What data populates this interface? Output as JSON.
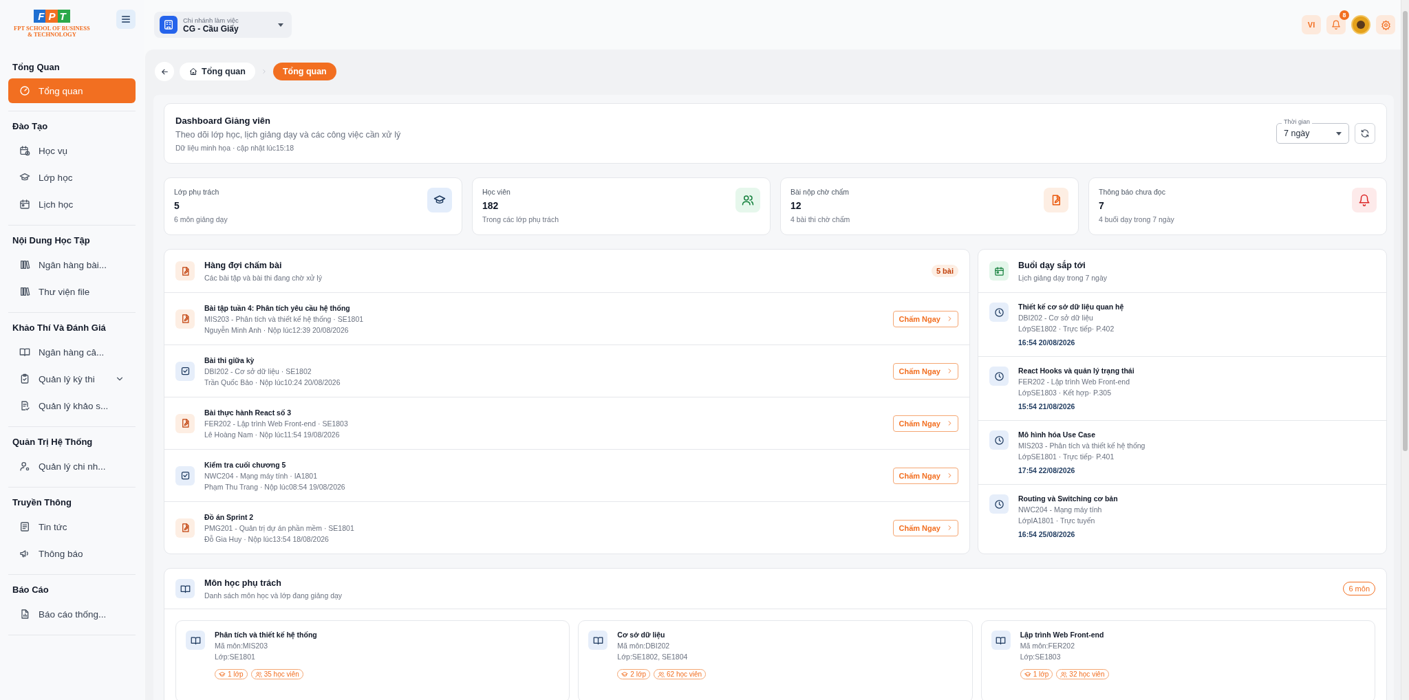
{
  "sidebar": {
    "logo": {
      "mark": "FPT",
      "lines": [
        "FPT SCHOOL OF BUSINESS",
        "& TECHNOLOGY"
      ]
    },
    "sections": [
      {
        "title": "Tổng Quan",
        "items": [
          {
            "label": "Tổng quan",
            "kind": "link",
            "selected": true
          }
        ]
      },
      {
        "title": "Đào Tạo",
        "items": [
          {
            "label": "Học vụ",
            "kind": "link",
            "selected": false
          },
          {
            "label": "Lớp học",
            "kind": "link",
            "selected": false
          },
          {
            "label": "Lịch học",
            "kind": "link",
            "selected": false
          }
        ]
      },
      {
        "title": "Nội Dung Học Tập",
        "items": [
          {
            "label": "Ngân hàng bài...",
            "kind": "link",
            "selected": false
          },
          {
            "label": "Thư viện file",
            "kind": "link",
            "selected": false
          }
        ]
      },
      {
        "title": "Khảo Thí Và Đánh Giá",
        "items": [
          {
            "label": "Ngân hàng câ...",
            "kind": "link",
            "selected": false
          },
          {
            "label": "Quản lý kỳ thi",
            "kind": "group",
            "selected": false
          },
          {
            "label": "Quản lý khảo s...",
            "kind": "link",
            "selected": false
          }
        ]
      },
      {
        "title": "Quản Trị Hệ Thống",
        "items": [
          {
            "label": "Quản lý chi nh...",
            "kind": "link",
            "selected": false
          }
        ]
      },
      {
        "title": "Truyền Thông",
        "items": [
          {
            "label": "Tin tức",
            "kind": "link",
            "selected": false
          },
          {
            "label": "Thông báo",
            "kind": "link",
            "selected": false
          }
        ]
      },
      {
        "title": "Báo Cáo",
        "items": [
          {
            "label": "Báo cáo thống...",
            "kind": "link",
            "selected": false
          }
        ]
      }
    ]
  },
  "header": {
    "branch": {
      "label": "Chi nhánh làm việc",
      "value": "CG - Cầu Giấy"
    },
    "language": "VI",
    "notification_count": "8"
  },
  "breadcrumb": [
    {
      "label": "Tổng quan",
      "selected": false
    },
    {
      "label": "Tổng quan",
      "selected": true
    }
  ],
  "dashboard_header": {
    "title": "Dashboard Giảng viên",
    "subtitle": "Theo dõi lớp học, lịch giảng dạy và các công việc cần xử lý",
    "meta": "Dữ liệu minh họa · cập nhật lúc15:18",
    "period": {
      "label": "Thời gian",
      "value": "7 ngày"
    }
  },
  "stats": [
    {
      "label": "Lớp phụ trách",
      "value": "5",
      "note": "6 môn giảng dạy"
    },
    {
      "label": "Học viên",
      "value": "182",
      "note": "Trong các lớp phụ trách"
    },
    {
      "label": "Bài nộp chờ chấm",
      "value": "12",
      "note": "4 bài thi chờ chấm"
    },
    {
      "label": "Thông báo chưa đọc",
      "value": "7",
      "note": "4 buổi dạy trong 7 ngày"
    }
  ],
  "grading_queue": {
    "title": "Hàng đợi chấm bài",
    "subtitle": "Các bài tập và bài thi đang chờ xử lý",
    "count": "5 bài",
    "items": [
      {
        "kind": "assignment",
        "title": "Bài tập tuần 4: Phân tích yêu cầu hệ thống",
        "course": "MIS203 - Phân tích và thiết kế hệ thống · SE1801",
        "submitted": "Nguyễn Minh Anh · Nộp lúc12:39 20/08/2026",
        "action": "Chấm Ngay"
      },
      {
        "kind": "exam",
        "title": "Bài thi giữa kỳ",
        "course": "DBI202 - Cơ sở dữ liệu · SE1802",
        "submitted": "Trần Quốc Bảo · Nộp lúc10:24 20/08/2026",
        "action": "Chấm Ngay"
      },
      {
        "kind": "assignment",
        "title": "Bài thực hành React số 3",
        "course": "FER202 - Lập trình Web Front-end · SE1803",
        "submitted": "Lê Hoàng Nam · Nộp lúc11:54 19/08/2026",
        "action": "Chấm Ngay"
      },
      {
        "kind": "exam",
        "title": "Kiểm tra cuối chương 5",
        "course": "NWC204 - Mạng máy tính · IA1801",
        "submitted": "Phạm Thu Trang · Nộp lúc08:54 19/08/2026",
        "action": "Chấm Ngay"
      },
      {
        "kind": "assignment",
        "title": "Đồ án Sprint 2",
        "course": "PMG201 - Quản trị dự án phần mềm · SE1801",
        "submitted": "Đỗ Gia Huy · Nộp lúc13:54 18/08/2026",
        "action": "Chấm Ngay"
      }
    ]
  },
  "upcoming": {
    "title": "Buổi dạy sắp tới",
    "subtitle": "Lịch giảng dạy trong 7 ngày",
    "items": [
      {
        "title": "Thiết kế cơ sở dữ liệu quan hệ",
        "course": "DBI202 - Cơ sở dữ liệu",
        "details": "LớpSE1802 · Trực tiếp· P.402",
        "time": "16:54 20/08/2026"
      },
      {
        "title": "React Hooks và quản lý trạng thái",
        "course": "FER202 - Lập trình Web Front-end",
        "details": "LớpSE1803 · Kết hợp· P.305",
        "time": "15:54 21/08/2026"
      },
      {
        "title": "Mô hình hóa Use Case",
        "course": "MIS203 - Phân tích và thiết kế hệ thống",
        "details": "LớpSE1801 · Trực tiếp· P.401",
        "time": "17:54 22/08/2026"
      },
      {
        "title": "Routing và Switching cơ bản",
        "course": "NWC204 - Mạng máy tính",
        "details": "LớpIA1801 · Trực tuyến",
        "time": "16:54 25/08/2026"
      }
    ]
  },
  "subjects": {
    "title": "Môn học phụ trách",
    "subtitle": "Danh sách môn học và lớp đang giảng dạy",
    "count": "6 môn",
    "items": [
      {
        "name": "Phân tích và thiết kế hệ thống",
        "code": "Mã môn:MIS203",
        "classes": "Lớp:SE1801",
        "class_count": "1 lớp",
        "students": "35 học viên"
      },
      {
        "name": "Cơ sở dữ liệu",
        "code": "Mã môn:DBI202",
        "classes": "Lớp:SE1802, SE1804",
        "class_count": "2 lớp",
        "students": "62 học viên"
      },
      {
        "name": "Lập trình Web Front-end",
        "code": "Mã môn:FER202",
        "classes": "Lớp:SE1803",
        "class_count": "1 lớp",
        "students": "32 học viên"
      }
    ]
  }
}
